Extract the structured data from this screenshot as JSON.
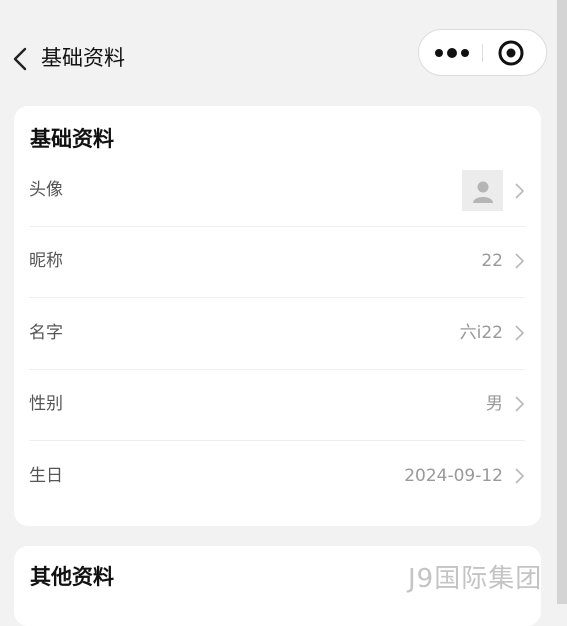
{
  "nav": {
    "title": "基础资料"
  },
  "basic_section": {
    "title": "基础资料",
    "rows": [
      {
        "label": "头像",
        "value": ""
      },
      {
        "label": "昵称",
        "value": "22"
      },
      {
        "label": "名字",
        "value": "六i22"
      },
      {
        "label": "性别",
        "value": "男"
      },
      {
        "label": "生日",
        "value": "2024-09-12"
      }
    ]
  },
  "other_section": {
    "title": "其他资料"
  },
  "watermark": "J9国际集团"
}
